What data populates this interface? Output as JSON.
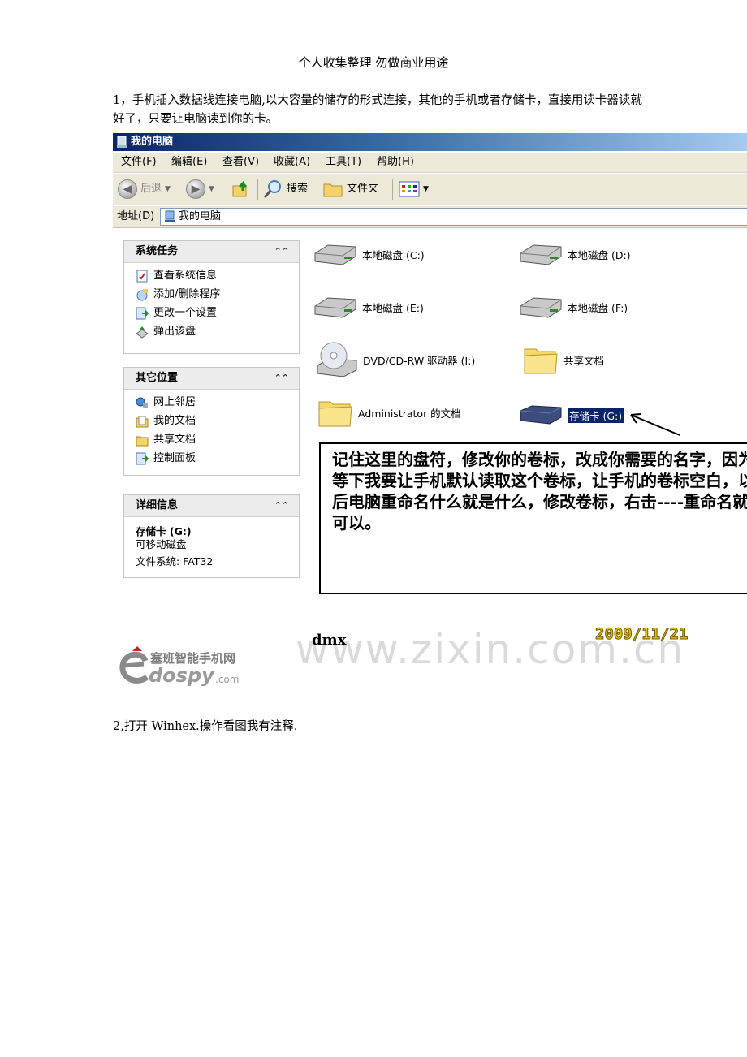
{
  "header": "个人收集整理 勿做商业用途",
  "para1": "1，手机插入数据线连接电脑,以大容量的储存的形式连接，其他的手机或者存储卡，直接用读卡器读就好了，只要让电脑读到你的卡。",
  "para2": "2,打开 Winhex.操作看图我有注释.",
  "window": {
    "title": "我的电脑",
    "menu": [
      "文件(F)",
      "编辑(E)",
      "查看(V)",
      "收藏(A)",
      "工具(T)",
      "帮助(H)"
    ],
    "toolbar": {
      "back": "后退",
      "search": "搜索",
      "folders": "文件夹"
    },
    "address_label": "地址(D)",
    "address_value": "我的电脑"
  },
  "panels": {
    "system": {
      "title": "系统任务",
      "items": [
        "查看系统信息",
        "添加/删除程序",
        "更改一个设置",
        "弹出该盘"
      ]
    },
    "other": {
      "title": "其它位置",
      "items": [
        "网上邻居",
        "我的文档",
        "共享文档",
        "控制面板"
      ]
    },
    "details": {
      "title": "详细信息",
      "name": "存储卡 (G:)",
      "type": "可移动磁盘",
      "fs": "文件系统: FAT32"
    }
  },
  "drives": {
    "c": "本地磁盘 (C:)",
    "d": "本地磁盘 (D:)",
    "e": "本地磁盘 (E:)",
    "f": "本地磁盘 (F:)",
    "dvd": "DVD/CD-RW 驱动器 (I:)",
    "shared": "共享文档",
    "admin": "Administrator 的文档",
    "card": "存储卡 (G:)"
  },
  "annotation": "记住这里的盘符，修改你的卷标，改成你需要的名字，因为等下我要让手机默认读取这个卷标，让手机的卷标空白，以后电脑重命名什么就是什么，修改卷标，右击----重命名就可以。",
  "signature": "dmx",
  "date": "2009/11/21",
  "logo": {
    "cn": "塞班智能手机网",
    "en": "dospy",
    "com": ".com"
  },
  "watermark": "www.zixin.com.cn",
  "colors": {
    "title_start": "#0a246a",
    "title_end": "#a6caf0",
    "date": "#e6c000"
  }
}
